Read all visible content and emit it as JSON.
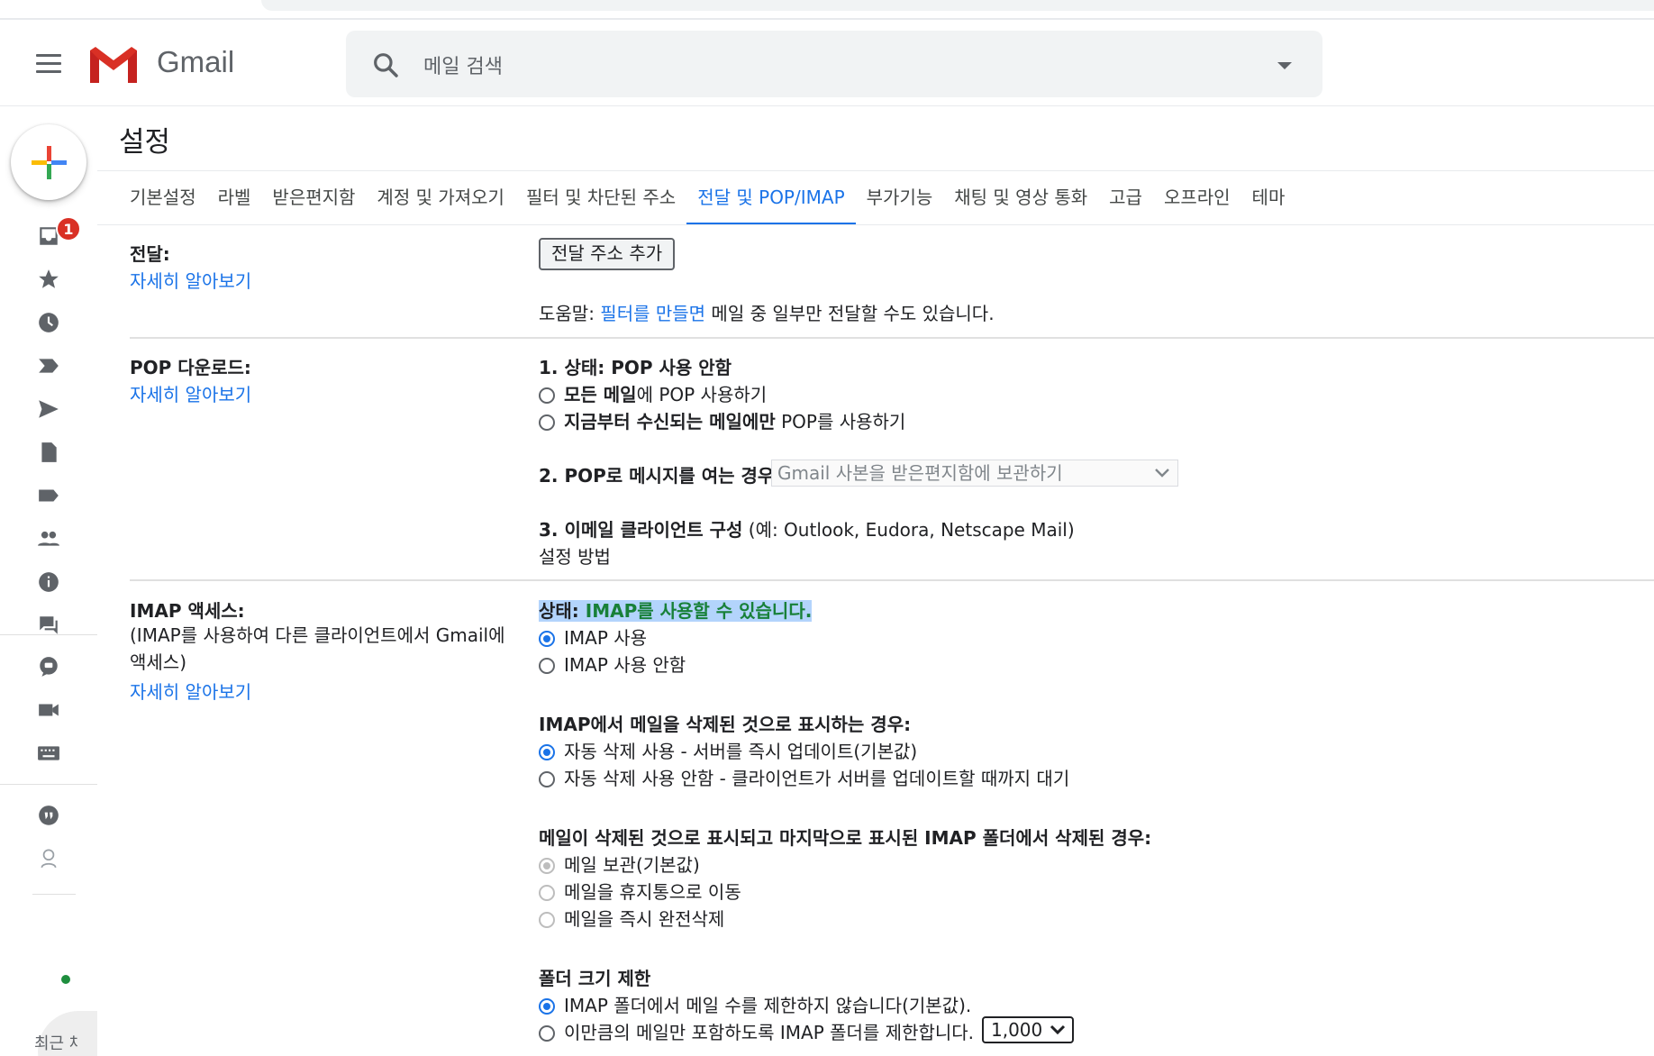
{
  "app": {
    "name": "Gmail"
  },
  "search": {
    "placeholder": "메일 검색"
  },
  "rail": {
    "unread_badge": "1",
    "recent_label": "최근 채"
  },
  "page": {
    "title": "설정"
  },
  "tabs": [
    {
      "label": "기본설정",
      "active": false
    },
    {
      "label": "라벨",
      "active": false
    },
    {
      "label": "받은편지함",
      "active": false
    },
    {
      "label": "계정 및 가져오기",
      "active": false
    },
    {
      "label": "필터 및 차단된 주소",
      "active": false
    },
    {
      "label": "전달 및 POP/IMAP",
      "active": true
    },
    {
      "label": "부가기능",
      "active": false
    },
    {
      "label": "채팅 및 영상 통화",
      "active": false
    },
    {
      "label": "고급",
      "active": false
    },
    {
      "label": "오프라인",
      "active": false
    },
    {
      "label": "테마",
      "active": false
    }
  ],
  "forwarding": {
    "label": "전달:",
    "learn_more": "자세히 알아보기",
    "add_button": "전달 주소 추가",
    "tip_prefix": "도움말: ",
    "tip_link": "필터를 만들면",
    "tip_suffix": " 메일 중 일부만 전달할 수도 있습니다."
  },
  "pop": {
    "label": "POP 다운로드:",
    "learn_more": "자세히 알아보기",
    "status": "1. 상태: POP 사용 안함",
    "opt1_bold": "모든 메일",
    "opt1_rest": "에 POP 사용하기",
    "opt2_bold": "지금부터 수신되는 메일에만",
    "opt2_rest": " POP를 사용하기",
    "when_open": "2. POP로 메시지를 여는 경우",
    "when_open_value": "Gmail 사본을 받은편지함에 보관하기",
    "client_bold": "3. 이메일 클라이언트 구성",
    "client_rest": " (예: Outlook, Eudora, Netscape Mail)",
    "setup_link": "설정 방법"
  },
  "imap": {
    "label": "IMAP 액세스:",
    "sub": "(IMAP를 사용하여 다른 클라이언트에서 Gmail에 액세스)",
    "learn_more": "자세히 알아보기",
    "status_prefix": "상태: ",
    "status_value": "IMAP를 사용할 수 있습니다.",
    "enable": "IMAP 사용",
    "disable": "IMAP 사용 안함",
    "delete_heading": "IMAP에서 메일을 삭제된 것으로 표시하는 경우:",
    "auto_on": "자동 삭제 사용 - 서버를 즉시 업데이트(기본값)",
    "auto_off": "자동 삭제 사용 안함 - 클라이언트가 서버를 업데이트할 때까지 대기",
    "expunge_heading": "메일이 삭제된 것으로 표시되고 마지막으로 표시된 IMAP 폴더에서 삭제된 경우:",
    "keep": "메일 보관(기본값)",
    "trash": "메일을 휴지통으로 이동",
    "delete_forever": "메일을 즉시 완전삭제",
    "folder_heading": "폴더 크기 제한",
    "no_limit": "IMAP 폴더에서 메일 수를 제한하지 않습니다(기본값).",
    "limit": "이만큼의 메일만 포함하도록 IMAP 폴더를 제한합니다.",
    "limit_value": "1,000"
  },
  "colors": {
    "accent": "#1a73e8",
    "badge": "#d93025",
    "status_green": "#188038"
  }
}
